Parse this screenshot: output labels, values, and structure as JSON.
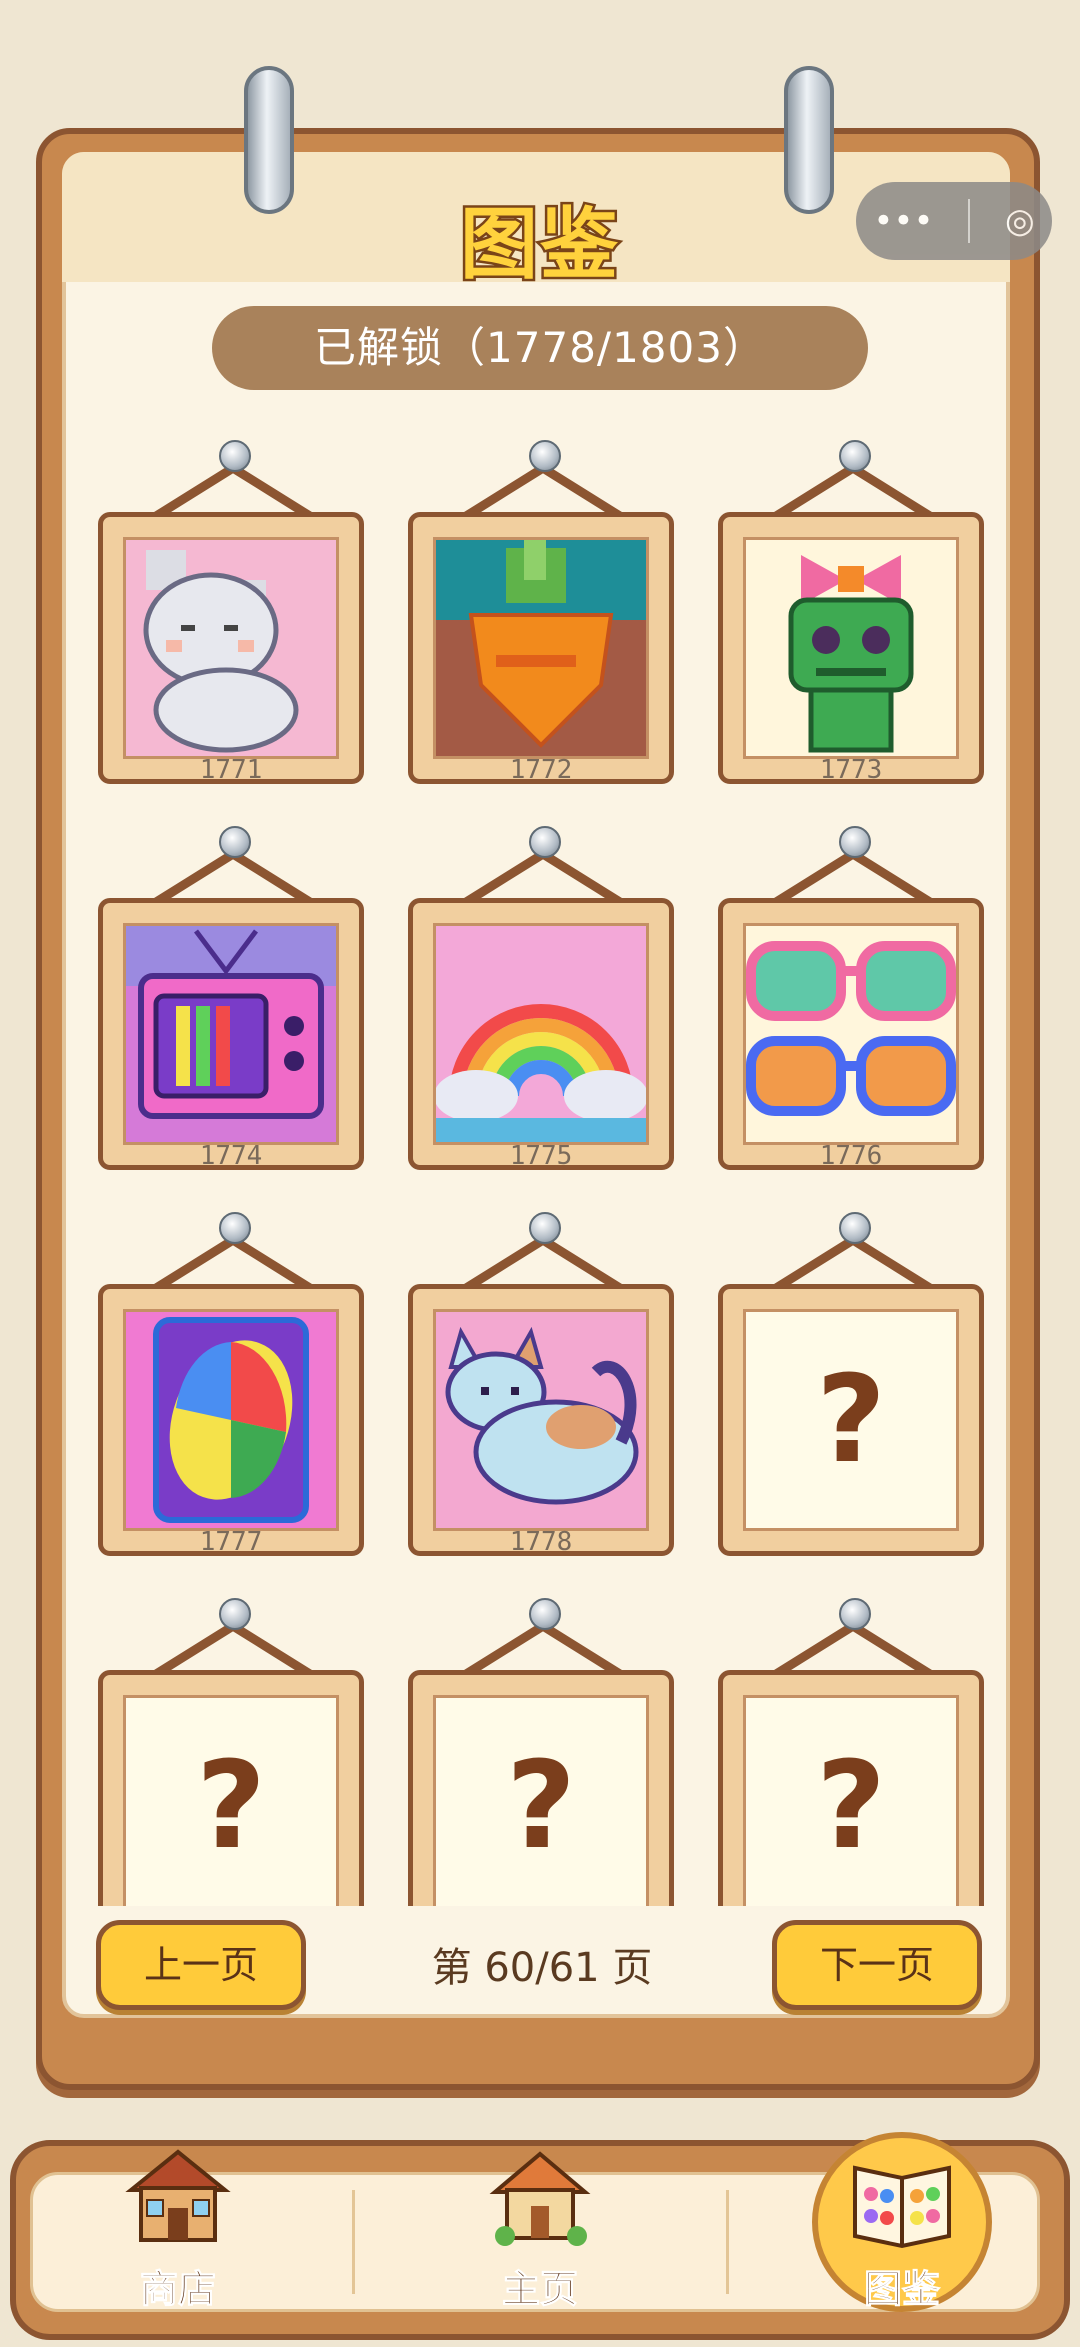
{
  "header": {
    "title": "图鉴",
    "unlock_text": "已解锁（1778/1803）"
  },
  "capsule": {
    "more_label": "•••",
    "close_label": "◎"
  },
  "gallery": {
    "items": [
      {
        "number": "1771",
        "icon": "white-cat-pixel-art",
        "locked": false
      },
      {
        "number": "1772",
        "icon": "carrot-pixel-art",
        "locked": false
      },
      {
        "number": "1773",
        "icon": "green-voodoo-doll-pixel-art",
        "locked": false
      },
      {
        "number": "1774",
        "icon": "retro-tv-pixel-art",
        "locked": false
      },
      {
        "number": "1775",
        "icon": "rainbow-pixel-art",
        "locked": false
      },
      {
        "number": "1776",
        "icon": "sunglasses-pixel-art",
        "locked": false
      },
      {
        "number": "1777",
        "icon": "card-pixel-art",
        "locked": false
      },
      {
        "number": "1778",
        "icon": "calico-cat-pixel-art",
        "locked": false
      },
      {
        "number": "",
        "icon": "question-mark",
        "locked": true,
        "placeholder": "?"
      },
      {
        "number": "",
        "icon": "question-mark",
        "locked": true,
        "placeholder": "?"
      },
      {
        "number": "",
        "icon": "question-mark",
        "locked": true,
        "placeholder": "?"
      },
      {
        "number": "",
        "icon": "question-mark",
        "locked": true,
        "placeholder": "?"
      }
    ]
  },
  "pagination": {
    "prev_label": "上一页",
    "next_label": "下一页",
    "page_text": "第 60/61 页"
  },
  "tabs": [
    {
      "label": "商店",
      "icon": "shop-house-icon"
    },
    {
      "label": "主页",
      "icon": "home-house-icon"
    },
    {
      "label": "图鉴",
      "icon": "gallery-book-icon",
      "active": true
    }
  ],
  "colors": {
    "board": "#c8884e",
    "paper": "#fbf4e4",
    "button": "#ffcb3a",
    "title": "#ffd23d"
  }
}
